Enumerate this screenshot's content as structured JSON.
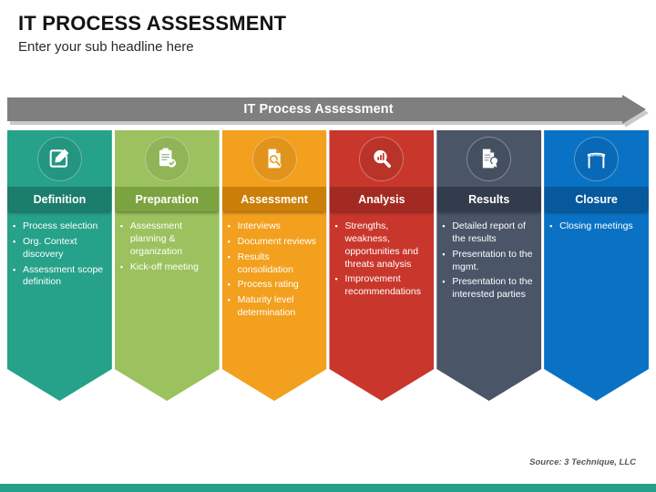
{
  "header": {
    "title": "IT PROCESS ASSESSMENT",
    "subtitle": "Enter your sub headline here"
  },
  "banner": {
    "label": "IT Process Assessment",
    "color": "#7f7f7f"
  },
  "footer": {
    "source": "Source: 3 Technique, LLC",
    "bar_color": "#27a08a"
  },
  "columns": [
    {
      "title": "Definition",
      "icon": "edit-square-icon",
      "color": "#26a18a",
      "title_color": "#1b7d6b",
      "bullets": [
        "Process selection",
        "Org. Context discovery",
        "Assessment scope definition"
      ]
    },
    {
      "title": "Preparation",
      "icon": "clipboard-check-icon",
      "color": "#9bc25e",
      "title_color": "#7ba33f",
      "bullets": [
        "Assessment planning & organization",
        "Kick-off meeting"
      ]
    },
    {
      "title": "Assessment",
      "icon": "document-search-icon",
      "color": "#f2a01e",
      "title_color": "#cb7f09",
      "bullets": [
        "Interviews",
        "Document reviews",
        "Results consolidation",
        "Process rating",
        "Maturity level determination"
      ]
    },
    {
      "title": "Analysis",
      "icon": "magnifier-chart-icon",
      "color": "#c9372c",
      "title_color": "#a32a22",
      "bullets": [
        "Strengths, weakness, opportunities and threats analysis",
        "Improvement recommendations"
      ]
    },
    {
      "title": "Results",
      "icon": "certificate-document-icon",
      "color": "#4a5568",
      "title_color": "#333c4c",
      "bullets": [
        "Detailed report of the results",
        "Presentation to the mgmt.",
        "Presentation to the interested parties"
      ]
    },
    {
      "title": "Closure",
      "icon": "finish-line-icon",
      "color": "#0a72c4",
      "title_color": "#05599c",
      "bullets": [
        "Closing meetings"
      ]
    }
  ]
}
